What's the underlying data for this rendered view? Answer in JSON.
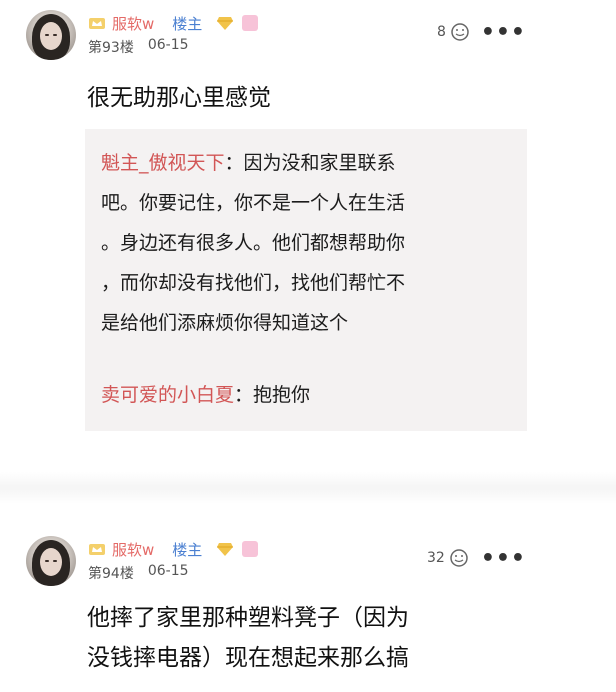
{
  "posts": [
    {
      "username": "服软w",
      "host_badge": "楼主",
      "floor": "第93楼",
      "date": "06-15",
      "likes": "8",
      "more": "•••",
      "content": "很无助那心里感觉",
      "replies": [
        {
          "author": "魁主_傲视天下",
          "separator": "：",
          "lines": [
            "因为没和家里联系",
            "吧。你要记住，你不是一个人在生活",
            "。身边还有很多人。他们都想帮助你",
            "，而你却没有找他们，找他们帮忙不",
            "是给他们添麻烦你得知道这个"
          ]
        },
        {
          "author": "卖可爱的小白夏",
          "separator": "：",
          "lines": [
            "抱抱你"
          ]
        }
      ]
    },
    {
      "username": "服软w",
      "host_badge": "楼主",
      "floor": "第94楼",
      "date": "06-15",
      "likes": "32",
      "more": "•••",
      "content_lines": [
        "他摔了家里那种塑料凳子（因为",
        "没钱摔电器）现在想起来那么搞"
      ]
    }
  ],
  "colors": {
    "username": "#e46a67",
    "host": "#4a7fd1",
    "reply_author": "#d25656",
    "reply_bg": "#f4f2f2"
  }
}
